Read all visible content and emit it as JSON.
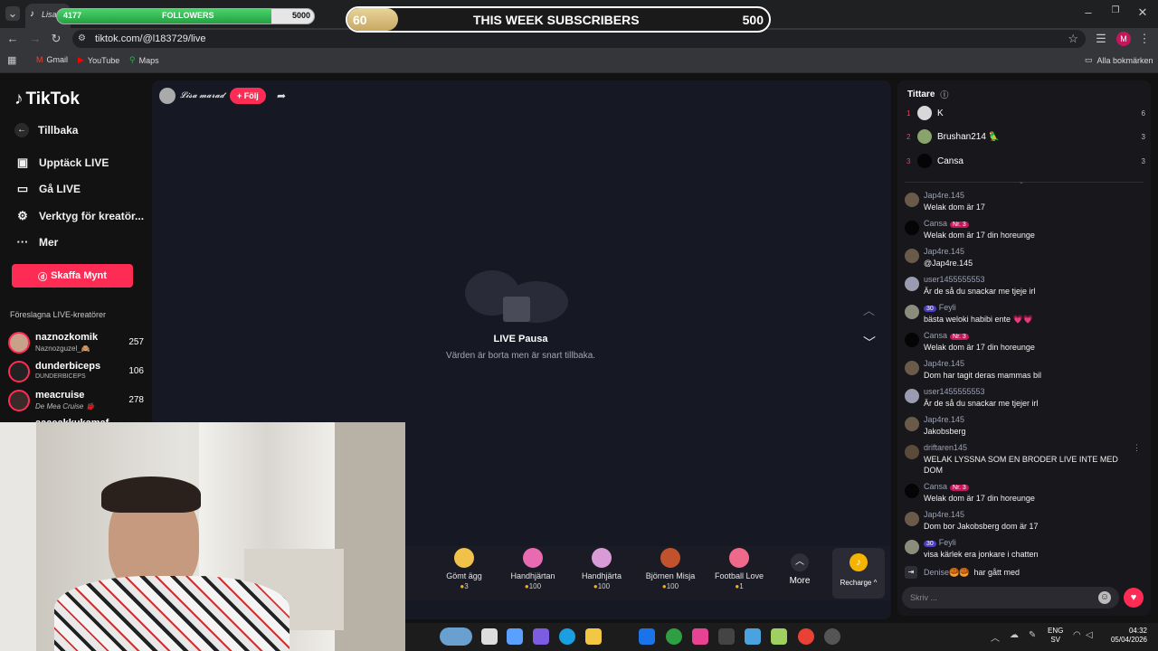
{
  "browser": {
    "tab_title": "Lisa",
    "url": "tiktok.com/@l183729/live",
    "bookmarks": [
      "Gmail",
      "YouTube",
      "Maps"
    ],
    "all_bookmarks": "Alla bokmärken",
    "profile_initial": "M"
  },
  "overlay": {
    "followers_count": "4177",
    "followers_label": "FOLLOWERS",
    "followers_goal": "5000",
    "followers_progress": 0.8354,
    "subs_count": "60",
    "subs_label": "THIS WEEK SUBSCRIBERS",
    "subs_goal": "500",
    "subs_progress": 0.12
  },
  "sidebar": {
    "logo": "TikTok",
    "back": "Tillbaka",
    "items": [
      {
        "label": "Upptäck LIVE",
        "icon": "calendar-icon"
      },
      {
        "label": "Gå LIVE",
        "icon": "video-camera-icon"
      },
      {
        "label": "Verktyg för kreatör...",
        "icon": "tools-icon"
      },
      {
        "label": "Mer",
        "icon": "more-icon"
      }
    ],
    "coins_button": "Skaffa Mynt",
    "suggested_title": "Föreslagna LIVE-kreatörer",
    "creators": [
      {
        "name": "naznozkomik",
        "sub": "Naznozguzel_🙈",
        "viewers": "257"
      },
      {
        "name": "dunderbiceps",
        "sub": "DUNDERBICEPS",
        "viewers": "106"
      },
      {
        "name": "meacruise",
        "sub": "De Mea Cruise 🐞",
        "viewers": "278"
      },
      {
        "name": "aaaeakkukamaf",
        "sub": "",
        "viewers": ""
      }
    ]
  },
  "live": {
    "host_name": "𝓛𝓲𝓼𝓪 𝓶𝓪𝓻𝓪𝓭",
    "follow_button": "+ Följ",
    "paused_title": "LIVE Pausa",
    "paused_sub": "Värden är borta men är snart tillbaka.",
    "gifts": [
      {
        "name": "Gömt ägg",
        "price": "3",
        "color": "#f0c24a"
      },
      {
        "name": "Handhjärtan",
        "price": "100",
        "color": "#e86ab0"
      },
      {
        "name": "Handhjärta",
        "price": "100",
        "color": "#d99bd8"
      },
      {
        "name": "Björnen Misja",
        "price": "100",
        "color": "#c0532e"
      },
      {
        "name": "Football Love",
        "price": "1",
        "color": "#ef6a8a"
      }
    ],
    "partial_gift": "tt",
    "more": "More",
    "recharge": "Recharge"
  },
  "viewers": {
    "title": "Tittare",
    "ranks": [
      {
        "rank": "1",
        "name": "K",
        "score": "6",
        "color": "#d8d8d8"
      },
      {
        "rank": "2",
        "name": "Brushan214 🦜",
        "score": "3",
        "color": "#8aa36c"
      },
      {
        "rank": "3",
        "name": "Cansa",
        "score": "3",
        "color": "#050505"
      }
    ]
  },
  "chat": {
    "messages": [
      {
        "user": "Jap4re.145",
        "text": "Welak dom är 17",
        "badge": "",
        "vip": "",
        "color": "#6a5a4a"
      },
      {
        "user": "Cansa",
        "text": "Welak dom är 17 din horeunge",
        "badge": "Nr. 3",
        "vip": "",
        "color": "#050505"
      },
      {
        "user": "Jap4re.145",
        "text": "@Jap4re.145",
        "badge": "",
        "vip": "",
        "color": "#6a5a4a"
      },
      {
        "user": "user1455555553",
        "text": "Är de så du snackar me tjeje irl",
        "badge": "",
        "vip": "",
        "color": "#9a9ab0"
      },
      {
        "user": "Feyli",
        "text": "bästa weloki habibi ente 💗💗",
        "badge": "",
        "vip": "30",
        "color": "#8c8c7c"
      },
      {
        "user": "Cansa",
        "text": "Welak dom är 17 din horeunge",
        "badge": "Nr. 3",
        "vip": "",
        "color": "#050505"
      },
      {
        "user": "Jap4re.145",
        "text": "Dom har tagit deras mammas bil",
        "badge": "",
        "vip": "",
        "color": "#6a5a4a"
      },
      {
        "user": "user1455555553",
        "text": "Är de så du snackar me tjejer irl",
        "badge": "",
        "vip": "",
        "color": "#9a9ab0"
      },
      {
        "user": "Jap4re.145",
        "text": "Jakobsberg",
        "badge": "",
        "vip": "",
        "color": "#6a5a4a"
      },
      {
        "user": "driftaren145",
        "text": "WELAK LYSSNA SOM EN BRODER LIVE INTE MED DOM",
        "badge": "",
        "vip": "",
        "color": "#5a4a3a"
      },
      {
        "user": "Cansa",
        "text": "Welak dom är 17 din horeunge",
        "badge": "Nr. 3",
        "vip": "",
        "color": "#050505"
      },
      {
        "user": "Jap4re.145",
        "text": "Dom bor Jakobsberg dom är 17",
        "badge": "",
        "vip": "",
        "color": "#6a5a4a"
      },
      {
        "user": "Feyli",
        "text": "visa kärlek era jonkare i chatten",
        "badge": "",
        "vip": "30",
        "color": "#8c8c7c"
      }
    ],
    "join_user": "Denise🥮🥮",
    "join_text": "har gått med",
    "input_placeholder": "Skriv ..."
  },
  "taskbar": {
    "lang1": "ENG",
    "lang2": "SV",
    "time": "04:32",
    "date": "05/04/2026"
  }
}
